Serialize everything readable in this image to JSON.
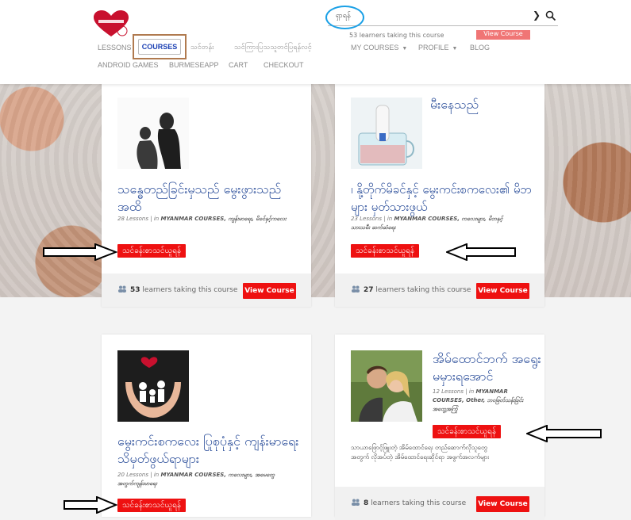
{
  "header": {
    "search": {
      "value": "ရှာရန်"
    },
    "ghost_text": "53 learners taking this course",
    "ghost_button": "View Course"
  },
  "nav": {
    "row1": [
      {
        "label": "LESSONS",
        "dropdown": false
      },
      {
        "label": "COURSES",
        "dropdown": false,
        "active": true
      },
      {
        "label": "သင်တန်း",
        "dropdown": false
      },
      {
        "label": "သင်ကြားပြသသူတင်ပြရန်လင့်",
        "dropdown": false
      },
      {
        "label": "MY COURSES",
        "dropdown": true
      },
      {
        "label": "PROFILE",
        "dropdown": true
      },
      {
        "label": "BLOG",
        "dropdown": false
      }
    ],
    "row2": [
      {
        "label": "ANDROID GAMES"
      },
      {
        "label": "BURMESEAPP"
      },
      {
        "label": "CART"
      },
      {
        "label": "CHECKOUT"
      }
    ]
  },
  "courses": [
    {
      "title": "သန္ဓေတည်ခြင်းမှသည် မွေးဖွားသည်အထိ",
      "lessons": "28 Lessons",
      "in_label": "in",
      "categories": "MYANMAR COURSES, ကျန်းမာရေး, မိခင်နှင့်ကလေး",
      "badge": "သင်ခန်းစာသင်ယူရန်",
      "learners_count": "53",
      "learners_text": "learners taking this course",
      "button": "View Course"
    },
    {
      "title": "မီးနေသည်",
      "subtitle": "၊ နို့တိုက်မိခင်နှင့် မွေးကင်းစကလေး၏ မိဘများ မှတ်သားဖွယ်",
      "lessons": "23 Lessons",
      "in_label": "in",
      "categories": "MYANMAR COURSES, ကလေးများ, မိဘနှင့်သားသမီး ဆက်ဆံရေး",
      "badge": "သင်ခန်းစာသင်ယူရန်",
      "learners_count": "27",
      "learners_text": "learners taking this course",
      "button": "View Course"
    },
    {
      "title": "မွေးကင်းစကလေး ပြုစုပုံနှင့် ကျန်းမာရေး သိမှတ်ဖွယ်ရာများ",
      "lessons": "20 Lessons",
      "in_label": "in",
      "categories": "MYANMAR COURSES, ကလေးများ, အမေတွေအတွက်ကျန်းမာရေး",
      "badge": "သင်ခန်းစာသင်ယူရန်"
    },
    {
      "title": "အိမ်ထောင်ဘက် အရွေးမမှားရအောင်",
      "lessons": "12 Lessons",
      "in_label": "in",
      "categories": "MYANMAR COURSES, Other, ဘဝဖြတ်သန်းခြင်းအတွေ့အကြုံ",
      "badge": "သင်ခန်းစာသင်ယူရန်",
      "description": "သာယာဖြောင့်ဖြူးတဲ့ အိမ်ထောင်ရေး တည်ဆောက်လိုသူတွေအတွက် လိုအပ်တဲ့ အိမ်ထောင်ရေးဆိုင်ရာ အဖွက်အလက်များ",
      "learners_count": "8",
      "learners_text": "learners taking this course",
      "button": "View Course"
    }
  ],
  "colors": {
    "accent": "#ee1111",
    "title": "#2b4e9a",
    "annotation_box": "#b07a4f",
    "annotation_circle": "#1aa0e6"
  }
}
